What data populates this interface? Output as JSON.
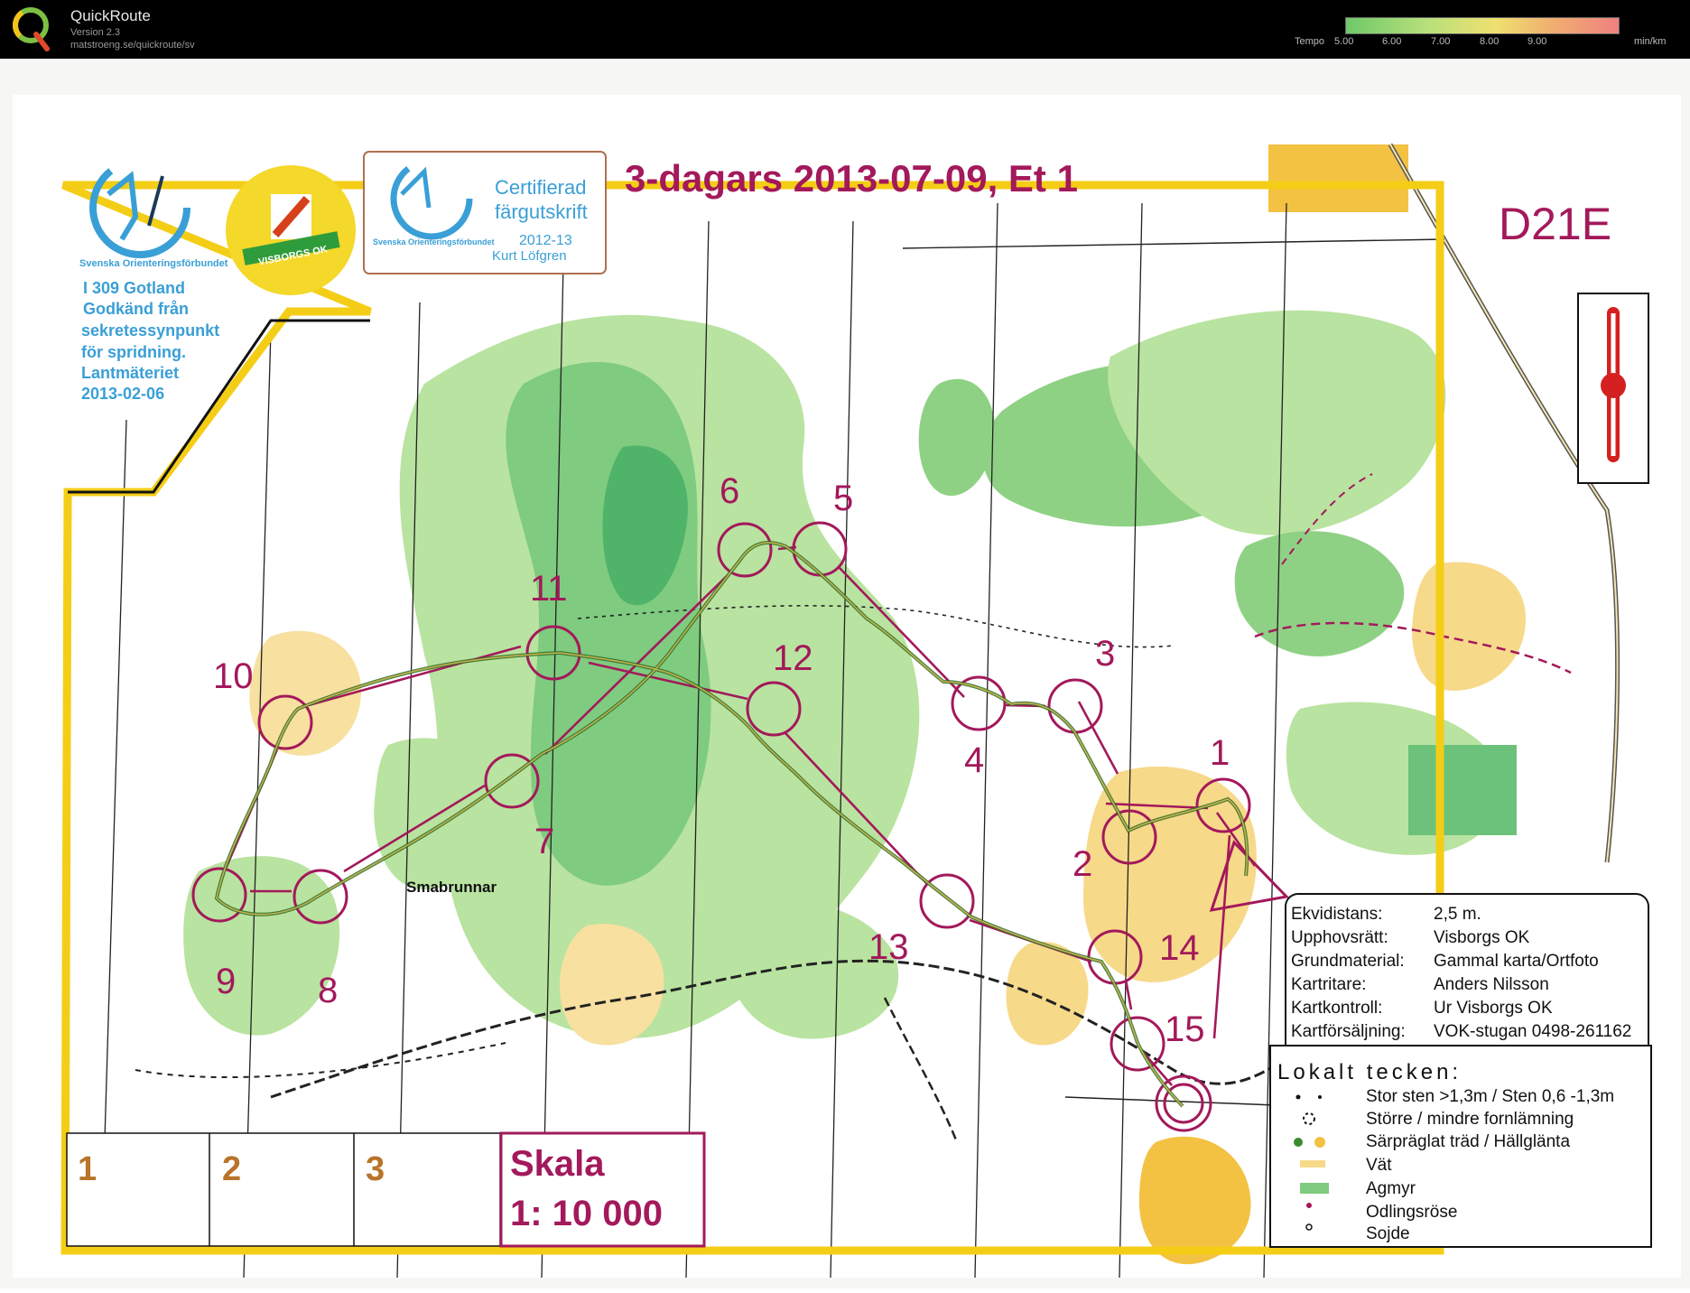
{
  "app": {
    "title": "QuickRoute",
    "version": "Version 2.3",
    "url": "matstroeng.se/quickroute/sv"
  },
  "tempo": {
    "label_prefix": "Tempo",
    "ticks": [
      "5.00",
      "6.00",
      "7.00",
      "8.00",
      "9.00"
    ],
    "unit": "min/km"
  },
  "map": {
    "title": "3-dagars 2013-07-09, Et 1",
    "class": "D21E",
    "place_name": "Smabrunnar",
    "federation": "Svenska Orienteringsförbundet",
    "club_logo_text": "VISBORGS OK",
    "certified": {
      "line1": "Certifierad",
      "line2": "färgutskrift",
      "year": "2012-13",
      "name": "Kurt Löfgren",
      "federation": "Svenska Orienteringsförbundet"
    },
    "permit": [
      "I 309 Gotland",
      "Godkänd från",
      "sekretessynpunkt",
      "för spridning.",
      "Lantmäteriet",
      "2013-02-06"
    ],
    "controls": [
      {
        "num": "1"
      },
      {
        "num": "2"
      },
      {
        "num": "3"
      },
      {
        "num": "4"
      },
      {
        "num": "5"
      },
      {
        "num": "6"
      },
      {
        "num": "7"
      },
      {
        "num": "8"
      },
      {
        "num": "9"
      },
      {
        "num": "10"
      },
      {
        "num": "11"
      },
      {
        "num": "12"
      },
      {
        "num": "13"
      },
      {
        "num": "14"
      },
      {
        "num": "15"
      }
    ],
    "info": [
      {
        "label": "Ekvidistans:",
        "value": "2,5 m."
      },
      {
        "label": "Upphovsrätt:",
        "value": "Visborgs OK"
      },
      {
        "label": "Grundmaterial:",
        "value": "Gammal karta/Ortfoto"
      },
      {
        "label": "Kartritare:",
        "value": "Anders Nilsson"
      },
      {
        "label": "Kartkontroll:",
        "value": "Ur Visborgs OK"
      },
      {
        "label": "Kartförsäljning:",
        "value": "VOK-stugan 0498-261162"
      }
    ],
    "legend_title": "Lokalt tecken:",
    "legend": [
      "Stor sten >1,3m / Sten 0,6 -1,3m",
      "Större / mindre fornlämning",
      "Särpräglat träd / Hällglänta",
      "Vät",
      "Agmyr",
      "Odlingsröse",
      "Sojde"
    ],
    "boxes": [
      "1",
      "2",
      "3"
    ],
    "scale_label": "Skala",
    "scale_value": "1: 10 000"
  },
  "colors": {
    "course": "#a3195b",
    "border": "#f4cd16",
    "forest": "#ffffff",
    "green_light": "#c6e8a8",
    "green_mid": "#8fd184",
    "green_dark": "#56b86a",
    "yellow": "#f7d98a",
    "route": "#2f6e2a"
  }
}
